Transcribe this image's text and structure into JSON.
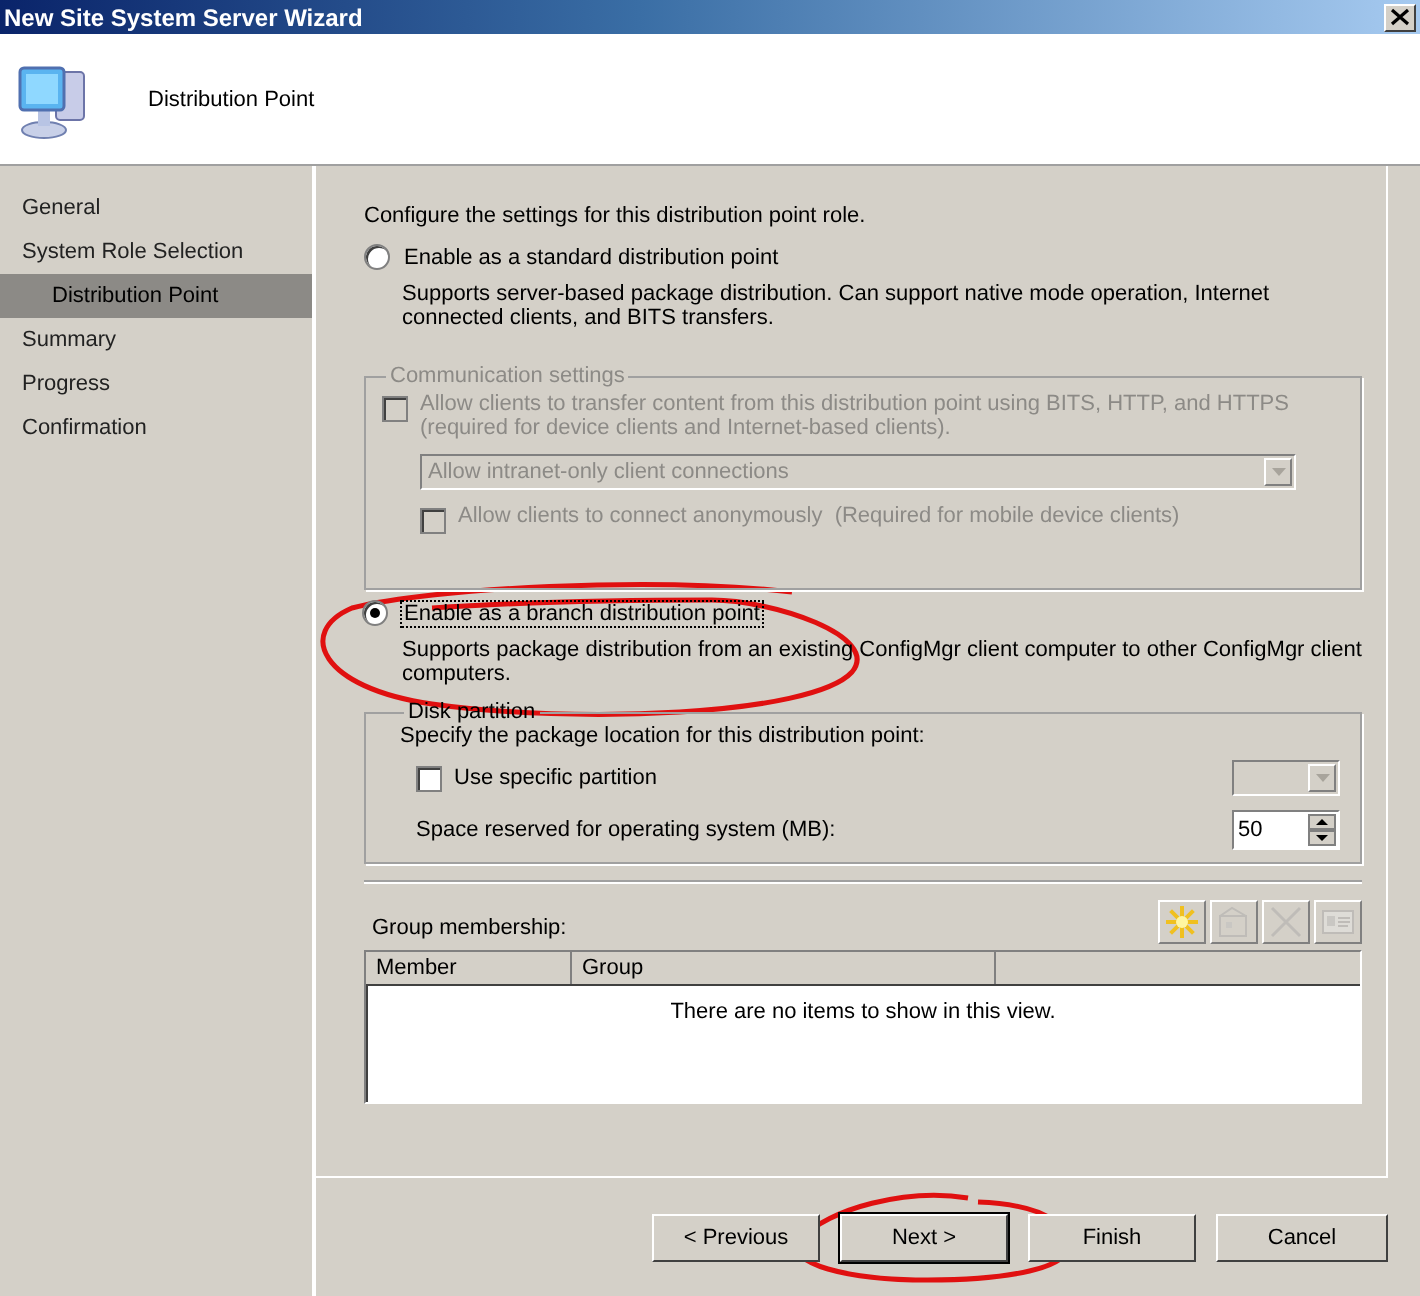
{
  "window": {
    "title": "New Site System Server Wizard"
  },
  "header": {
    "title": "Distribution Point"
  },
  "steps": [
    {
      "label": "General",
      "selected": false,
      "indented": false
    },
    {
      "label": "System Role Selection",
      "selected": false,
      "indented": false
    },
    {
      "label": "Distribution Point",
      "selected": true,
      "indented": true
    },
    {
      "label": "Summary",
      "selected": false,
      "indented": false
    },
    {
      "label": "Progress",
      "selected": false,
      "indented": false
    },
    {
      "label": "Confirmation",
      "selected": false,
      "indented": false
    }
  ],
  "intro": "Configure the settings for this distribution point role.",
  "standard_option": {
    "label": "Enable as a standard distribution point",
    "description": "Supports server-based package distribution. Can support native mode operation, Internet connected clients, and BITS transfers.",
    "selected": false
  },
  "communication_settings": {
    "title": "Communication settings",
    "disabled": true,
    "allow_transfer": {
      "label": "Allow clients to transfer content from this distribution point using BITS, HTTP, and HTTPS (required for device clients and Internet-based clients).",
      "checked": false
    },
    "connection_mode": {
      "value": "Allow intranet-only client connections"
    },
    "allow_anonymous": {
      "label": "Allow clients to connect anonymously  (Required for mobile device clients)",
      "checked": false
    }
  },
  "branch_option": {
    "label": "Enable as a branch distribution point",
    "description": "Supports package distribution from an existing ConfigMgr client computer to other ConfigMgr client computers.",
    "selected": true
  },
  "disk_partition": {
    "title": "Disk partition",
    "prompt": "Specify the package location for this distribution point:",
    "use_specific": {
      "label": "Use specific partition",
      "checked": false
    },
    "reserved": {
      "label": "Space reserved for operating system (MB):",
      "value": "50"
    }
  },
  "group_membership": {
    "label": "Group membership:",
    "tools": [
      {
        "kind": "new",
        "disabled": false
      },
      {
        "kind": "properties",
        "disabled": true
      },
      {
        "kind": "delete",
        "disabled": true
      },
      {
        "kind": "details",
        "disabled": true
      }
    ],
    "columns": [
      "Member",
      "Group"
    ],
    "empty_text": "There are no items to show in this view."
  },
  "buttons": [
    {
      "label": "< Previous",
      "default": false
    },
    {
      "label": "Next >",
      "default": true
    },
    {
      "label": "Finish",
      "default": false
    },
    {
      "label": "Cancel",
      "default": false
    }
  ]
}
